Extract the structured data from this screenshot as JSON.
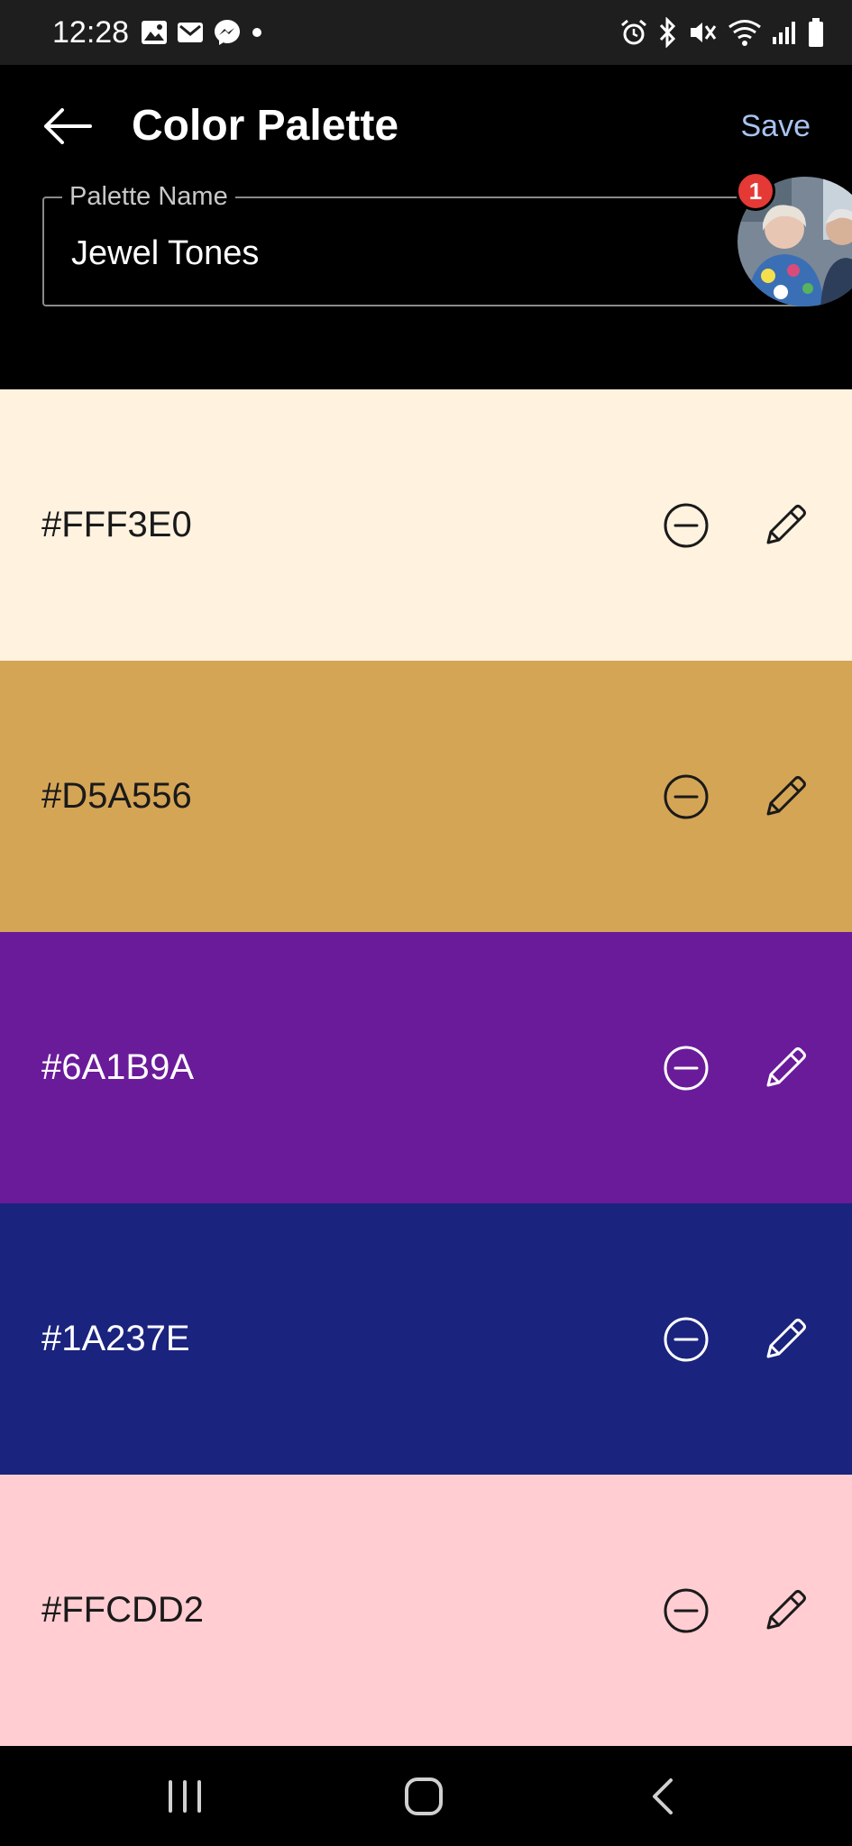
{
  "status_bar": {
    "time": "12:28",
    "left_icons": [
      "gallery-icon",
      "gmail-icon",
      "messenger-icon",
      "dot-icon"
    ],
    "right_icons": [
      "alarm-icon",
      "bluetooth-icon",
      "mute-icon",
      "wifi-icon",
      "signal-icon",
      "battery-icon"
    ]
  },
  "app_bar": {
    "title": "Color Palette",
    "save_label": "Save",
    "back_icon": "arrow-back-icon"
  },
  "name_field": {
    "label": "Palette Name",
    "value": "Jewel Tones"
  },
  "chat_head": {
    "badge_count": "1"
  },
  "colors": [
    {
      "hex": "#FFF3E0",
      "background": "#FFF3E0",
      "text_color": "#1a1a1a"
    },
    {
      "hex": "#D5A556",
      "background": "#D5A556",
      "text_color": "#1a1a1a"
    },
    {
      "hex": "#6A1B9A",
      "background": "#6A1B9A",
      "text_color": "#ffffff"
    },
    {
      "hex": "#1A237E",
      "background": "#1A237E",
      "text_color": "#ffffff"
    },
    {
      "hex": "#FFCDD2",
      "background": "#FFCDD2",
      "text_color": "#1a1a1a"
    }
  ],
  "nav_bar": {
    "buttons": [
      "recents-icon",
      "home-icon",
      "back-nav-icon"
    ]
  },
  "theme": {
    "accent": "#A8C3F0",
    "background": "#000000"
  }
}
